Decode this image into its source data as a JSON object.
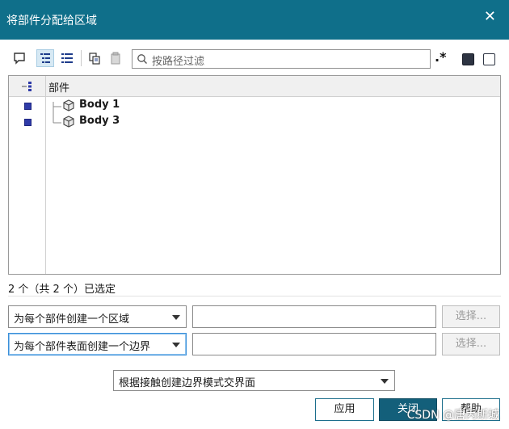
{
  "dialog": {
    "title": "将部件分配给区域"
  },
  "toolbar": {
    "search_placeholder": "按路径过滤",
    "regex_label": ".*"
  },
  "tree": {
    "header": "部件",
    "items": [
      {
        "label": "Body 1"
      },
      {
        "label": "Body 3"
      }
    ]
  },
  "status": {
    "selection_text": "2 个（共 2 个）已选定"
  },
  "options": {
    "region_mode": "为每个部件创建一个区域",
    "boundary_mode": "为每个部件表面创建一个边界",
    "interface_mode": "根据接触创建边界模式交界面",
    "select_label_1": "选择...",
    "select_label_2": "选择..."
  },
  "buttons": {
    "apply": "应用",
    "close": "关闭",
    "help": "帮助"
  },
  "watermark": "CSDN @唐丙斯城",
  "colors": {
    "titlebar": "#0f6f8a",
    "primary_button": "#135f7a",
    "tree_marker": "#2f3ba8"
  }
}
